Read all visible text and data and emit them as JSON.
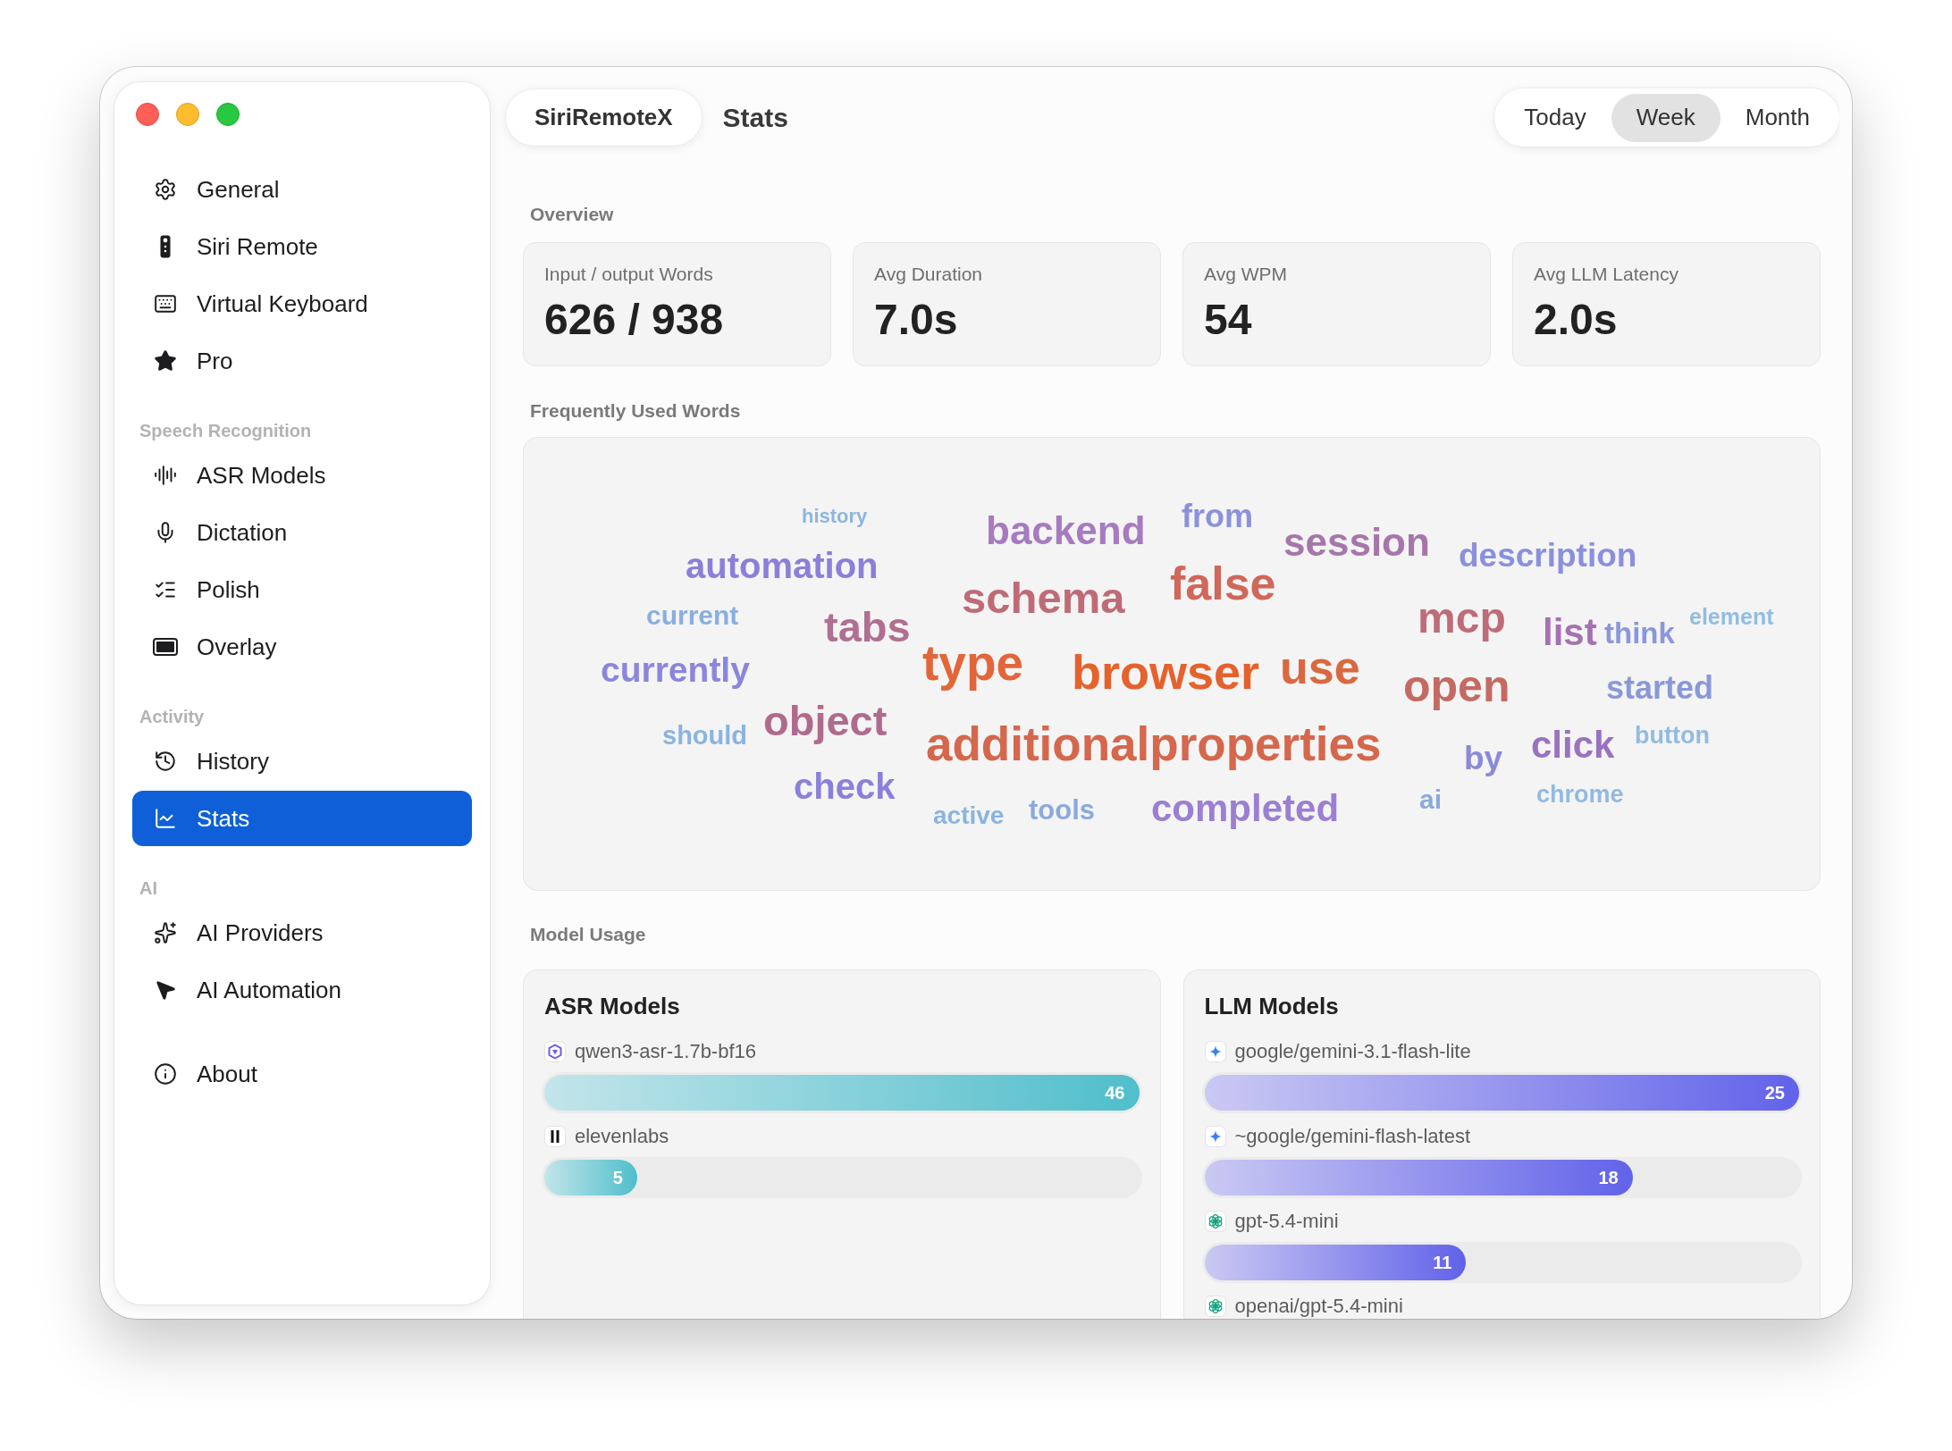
{
  "sidebar": {
    "groups": [
      {
        "items": [
          {
            "label": "General",
            "selected": false
          },
          {
            "label": "Siri Remote",
            "selected": false
          },
          {
            "label": "Virtual Keyboard",
            "selected": false
          },
          {
            "label": "Pro",
            "selected": false
          }
        ]
      },
      {
        "title": "Speech Recognition",
        "items": [
          {
            "label": "ASR Models",
            "selected": false
          },
          {
            "label": "Dictation",
            "selected": false
          },
          {
            "label": "Polish",
            "selected": false
          },
          {
            "label": "Overlay",
            "selected": false
          }
        ]
      },
      {
        "title": "Activity",
        "items": [
          {
            "label": "History",
            "selected": false
          },
          {
            "label": "Stats",
            "selected": true
          }
        ]
      },
      {
        "title": "AI",
        "items": [
          {
            "label": "AI Providers",
            "selected": false
          },
          {
            "label": "AI Automation",
            "selected": false
          }
        ]
      },
      {
        "items": [
          {
            "label": "About",
            "selected": false
          }
        ]
      }
    ]
  },
  "header": {
    "app_name": "SiriRemoteX",
    "title": "Stats",
    "periods": [
      {
        "label": "Today",
        "selected": false
      },
      {
        "label": "Week",
        "selected": true
      },
      {
        "label": "Month",
        "selected": false
      }
    ]
  },
  "overview": {
    "title": "Overview",
    "cards": [
      {
        "label": "Input / output Words",
        "value": "626 / 938"
      },
      {
        "label": "Avg Duration",
        "value": "7.0s"
      },
      {
        "label": "Avg WPM",
        "value": "54"
      },
      {
        "label": "Avg LLM Latency",
        "value": "2.0s"
      }
    ]
  },
  "frequent_words": {
    "title": "Frequently Used Words",
    "words": [
      {
        "text": "history",
        "color": "#8db5e0"
      },
      {
        "text": "backend",
        "color": "#a67bbf"
      },
      {
        "text": "from",
        "color": "#8a92dc"
      },
      {
        "text": "automation",
        "color": "#8b7fd9"
      },
      {
        "text": "session",
        "color": "#a676aa"
      },
      {
        "text": "description",
        "color": "#8a90dc"
      },
      {
        "text": "schema",
        "color": "#bf6b76"
      },
      {
        "text": "false",
        "color": "#d0675a"
      },
      {
        "text": "current",
        "color": "#8aaee0"
      },
      {
        "text": "tabs",
        "color": "#b06f90"
      },
      {
        "text": "mcp",
        "color": "#bd6c78"
      },
      {
        "text": "list",
        "color": "#a571b3"
      },
      {
        "text": "think",
        "color": "#8a97dc"
      },
      {
        "text": "element",
        "color": "#92bde0"
      },
      {
        "text": "currently",
        "color": "#8b86dc"
      },
      {
        "text": "type",
        "color": "#e2663a"
      },
      {
        "text": "browser",
        "color": "#e5622c"
      },
      {
        "text": "use",
        "color": "#da6840"
      },
      {
        "text": "open",
        "color": "#c46a63"
      },
      {
        "text": "started",
        "color": "#8a98da"
      },
      {
        "text": "should",
        "color": "#8ab4e0"
      },
      {
        "text": "object",
        "color": "#b06b8c"
      },
      {
        "text": "additionalproperties",
        "color": "#d4674c"
      },
      {
        "text": "by",
        "color": "#8a89da"
      },
      {
        "text": "click",
        "color": "#9a72c2"
      },
      {
        "text": "button",
        "color": "#92bbe0"
      },
      {
        "text": "check",
        "color": "#8a80dc"
      },
      {
        "text": "active",
        "color": "#8ab4e0"
      },
      {
        "text": "tools",
        "color": "#8aaade"
      },
      {
        "text": "completed",
        "color": "#9a7fd2"
      },
      {
        "text": "ai",
        "color": "#8aaade"
      },
      {
        "text": "chrome",
        "color": "#92bae0"
      }
    ]
  },
  "model_usage": {
    "title": "Model Usage",
    "panels": [
      {
        "title": "ASR Models",
        "models": [
          {
            "name": "qwen3-asr-1.7b-bf16",
            "count": "46",
            "level": 1
          },
          {
            "name": "elevenlabs",
            "count": "5",
            "level": 0.156
          }
        ]
      },
      {
        "title": "LLM Models",
        "models": [
          {
            "name": "google/gemini-3.1-flash-lite",
            "count": "25",
            "level": 1
          },
          {
            "name": "~google/gemini-flash-latest",
            "count": "18",
            "level": 0.72
          },
          {
            "name": "gpt-5.4-mini",
            "count": "11",
            "level": 0.44
          },
          {
            "name": "openai/gpt-5.4-mini"
          }
        ]
      }
    ]
  }
}
